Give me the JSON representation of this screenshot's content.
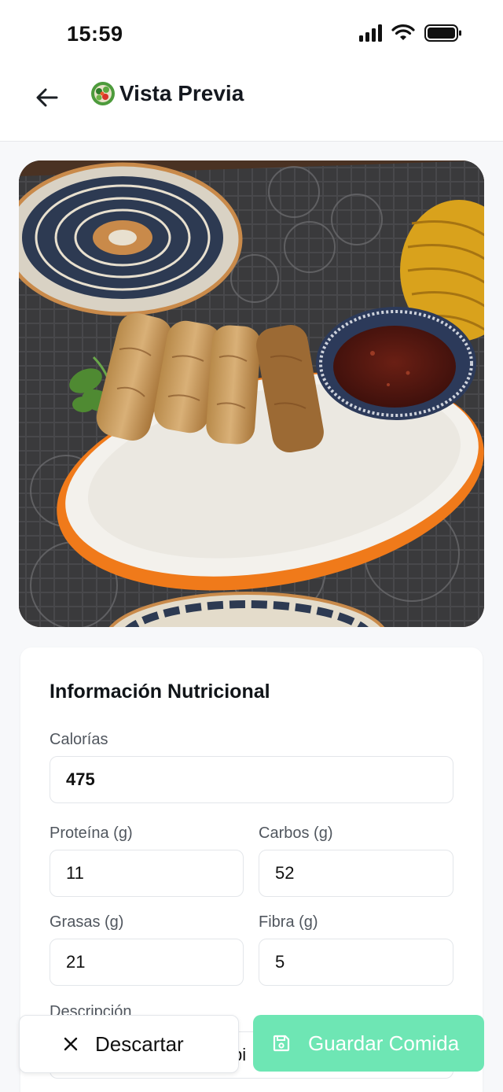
{
  "status_bar": {
    "time": "15:59"
  },
  "header": {
    "title": "Vista Previa",
    "back_icon": "arrow-left-icon",
    "title_icon": "salad-icon"
  },
  "photo": {
    "alt": "spring-rolls-plate"
  },
  "nutrition": {
    "title": "Información Nutricional",
    "calories": {
      "label": "Calorías",
      "value": "475"
    },
    "protein": {
      "label": "Proteína (g)",
      "value": "11"
    },
    "carbs": {
      "label": "Carbos (g)",
      "value": "52"
    },
    "fat": {
      "label": "Grasas (g)",
      "value": "21"
    },
    "fiber": {
      "label": "Fibra (g)",
      "value": "5"
    },
    "description": {
      "label": "Descripción",
      "value_fragment": "pi"
    }
  },
  "actions": {
    "discard_label": "Descartar",
    "save_label": "Guardar Comida"
  },
  "colors": {
    "accent": "#6ee6b4",
    "orange_rim": "#f07a1a"
  }
}
